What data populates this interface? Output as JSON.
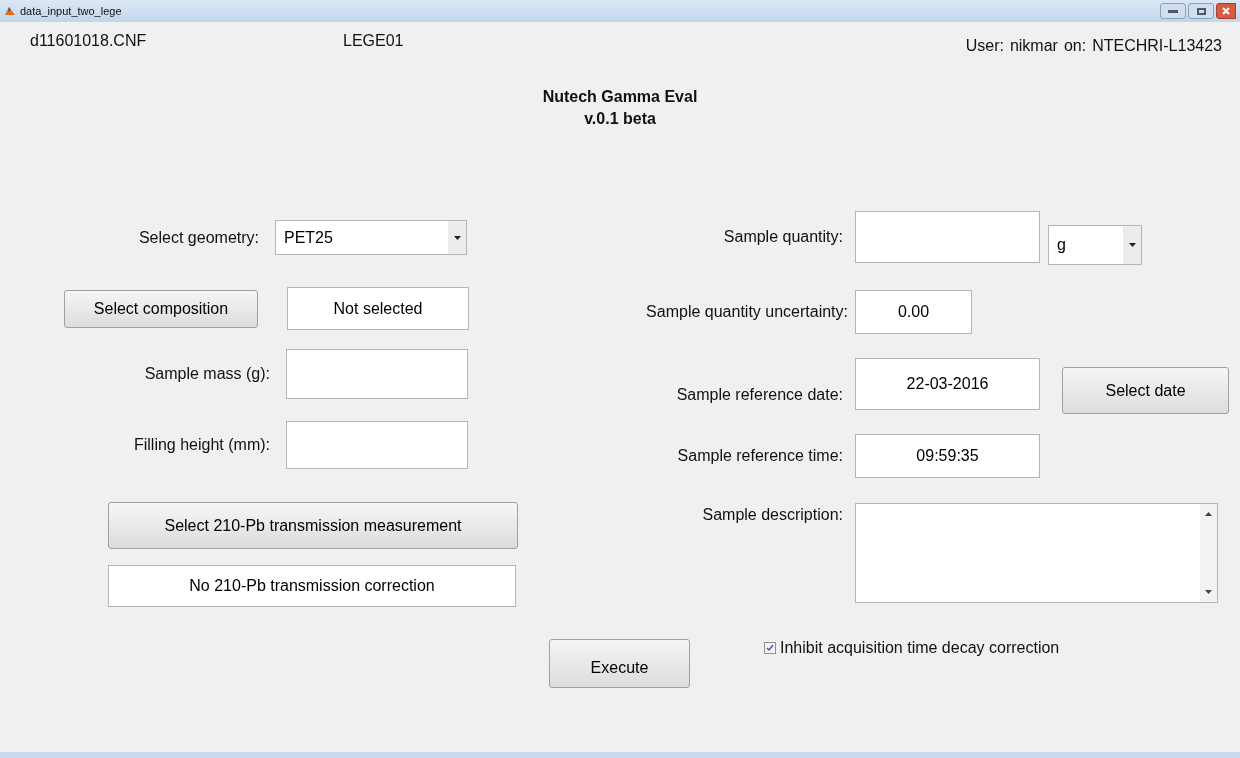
{
  "window": {
    "title": "data_input_two_lege"
  },
  "header": {
    "file": "d11601018.CNF",
    "detector": "LEGE01",
    "user_label": "User:",
    "user": "nikmar",
    "on_label": "on:",
    "host": "NTECHRI-L13423"
  },
  "app_title": [
    "Nutech Gamma Eval",
    "v.0.1 beta"
  ],
  "left": {
    "geometry": {
      "label": "Select geometry:",
      "value": "PET25"
    },
    "composition": {
      "button": "Select composition",
      "value": "Not selected"
    },
    "sample_mass": {
      "label": "Sample mass (g):"
    },
    "filling_height": {
      "label": "Filling height (mm):"
    },
    "transmission": {
      "button": "Select 210-Pb transmission measurement",
      "value": "No 210-Pb transmission correction"
    }
  },
  "right": {
    "quantity": {
      "label": "Sample quantity:",
      "unit": "g"
    },
    "uncertainty": {
      "label": "Sample quantity uncertainty:",
      "value": "0.00"
    },
    "ref_date": {
      "label": "Sample reference date:",
      "value": "22-03-2016",
      "button": "Select date"
    },
    "ref_time": {
      "label": "Sample reference time:",
      "value": "09:59:35"
    },
    "description": {
      "label": "Sample description:"
    }
  },
  "inhibit_decay": {
    "label": "Inhibit acquisition time decay correction",
    "checked": true
  },
  "execute": "Execute"
}
